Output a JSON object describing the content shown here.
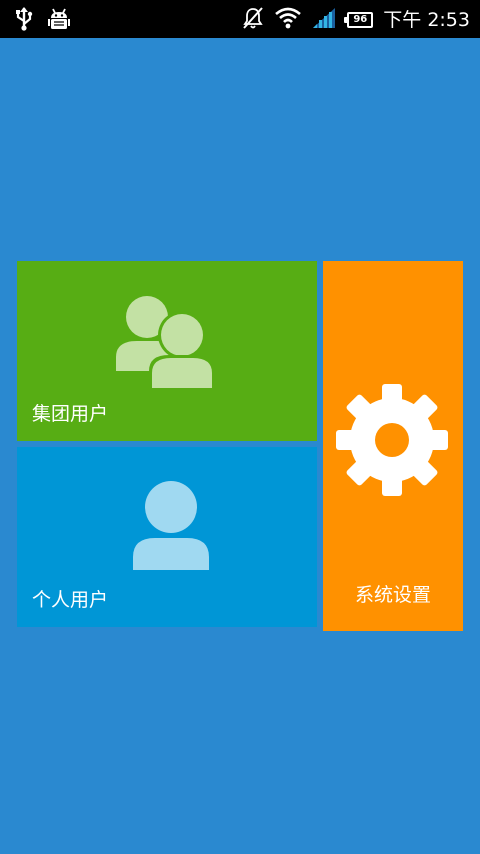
{
  "status_bar": {
    "time": "下午 2:53",
    "battery_level": "96",
    "icons": [
      "usb-icon",
      "android-debug-icon",
      "notifications-muted-icon",
      "wifi-icon",
      "signal-icon",
      "battery-icon"
    ]
  },
  "tiles": {
    "group_users": {
      "label": "集团用户",
      "icon": "group-users-icon",
      "color": "#57ad14"
    },
    "personal_users": {
      "label": "个人用户",
      "icon": "user-icon",
      "color": "#0096d6"
    },
    "system_settings": {
      "label": "系统设置",
      "icon": "gear-icon",
      "color": "#ff9100"
    }
  },
  "colors": {
    "background": "#2a89d0",
    "status_bar": "#000000"
  }
}
